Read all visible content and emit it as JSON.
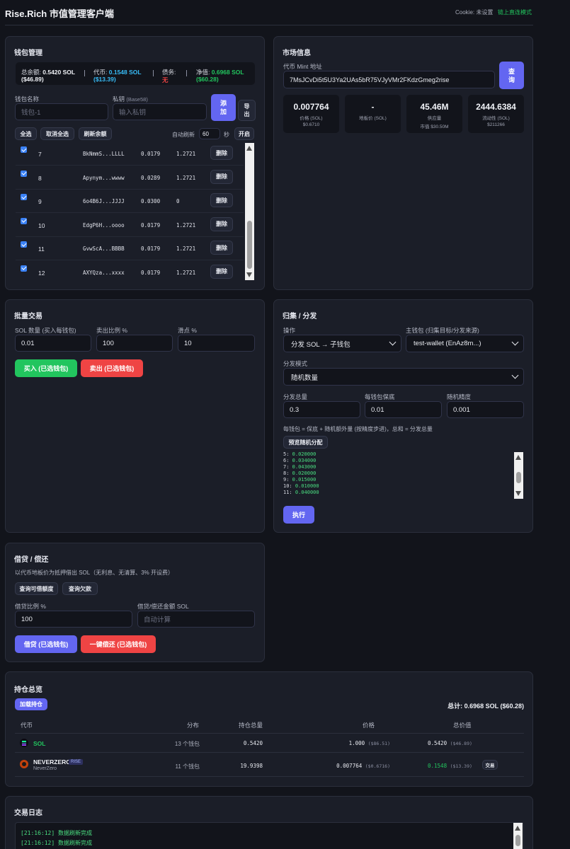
{
  "header": {
    "title": "Rise.Rich 市值管理客户端",
    "cookie_label": "Cookie: 未设置",
    "mode_label": "链上直连模式"
  },
  "wallet": {
    "title": "钱包管理",
    "summary": {
      "total_label": "总余额:",
      "total_value": "0.5420 SOL",
      "total_usd": "($46.89)",
      "token_label": "代币:",
      "token_value": "0.1548 SOL",
      "token_usd": "($13.39)",
      "debt_label": "债务:",
      "debt_value": "无",
      "net_label": "净值:",
      "net_value": "0.6968 SOL",
      "net_usd": "($60.28)"
    },
    "name_label": "钱包名称",
    "name_placeholder": "钱包-1",
    "key_label": "私钥",
    "key_hint": "(Base58)",
    "key_placeholder": "输入私钥",
    "add_button": "添加",
    "export_button": "导出",
    "select_all": "全选",
    "deselect_all": "取消全选",
    "refresh_balance": "刷新余额",
    "auto_refresh_label": "自动刷新",
    "auto_refresh_value": "60",
    "seconds_label": "秒",
    "start_button": "开启",
    "delete_label": "删除",
    "rows": [
      {
        "idx": "7",
        "addr": "BkNmmS...LLLL",
        "sol": "0.0179",
        "token": "1.2721",
        "checked": true
      },
      {
        "idx": "8",
        "addr": "Apynym...wwww",
        "sol": "0.0289",
        "token": "1.2721",
        "checked": true
      },
      {
        "idx": "9",
        "addr": "6o4B6J...JJJJ",
        "sol": "0.0300",
        "token": "0",
        "checked": true
      },
      {
        "idx": "10",
        "addr": "EdgP6H...oooo",
        "sol": "0.0179",
        "token": "1.2721",
        "checked": true
      },
      {
        "idx": "11",
        "addr": "GvwScA...BBBB",
        "sol": "0.0179",
        "token": "1.2721",
        "checked": true
      },
      {
        "idx": "12",
        "addr": "AXYQza...xxxx",
        "sol": "0.0179",
        "token": "1.2721",
        "checked": true
      }
    ]
  },
  "market": {
    "title": "市场信息",
    "mint_label": "代币 Mint 地址",
    "mint_value": "7MsJCvDi5t5U3Ya2UAs5bR75VJyVMr2FKdzGmeg2rise",
    "query_button": "查询",
    "stats": [
      {
        "value": "0.007764",
        "label": "价格 (SOL)",
        "sub": "$0.6710"
      },
      {
        "value": "-",
        "label": "地板价 (SOL)",
        "sub": ""
      },
      {
        "value": "45.46M",
        "label": "供应量",
        "sub": "市值 $30.50M"
      },
      {
        "value": "2444.6384",
        "label": "流动性 (SOL)",
        "sub": "$211266"
      }
    ]
  },
  "batch": {
    "title": "批量交易",
    "sol_label": "SOL 数量 (买入每钱包)",
    "sol_value": "0.01",
    "sell_label": "卖出比例 %",
    "sell_value": "100",
    "slip_label": "滑点 %",
    "slip_value": "10",
    "buy_button": "买入 (已选钱包)",
    "sell_button": "卖出 (已选钱包)"
  },
  "collect": {
    "title": "归集 / 分发",
    "op_label": "操作",
    "op_value": "分发 SOL → 子钱包",
    "main_label": "主钱包 (归集目标/分发来源)",
    "main_value": "test-wallet (EnAz8m...)",
    "mode_label": "分发模式",
    "mode_value": "随机数量",
    "total_label": "分发总量",
    "total_value": "0.3",
    "min_label": "每钱包保底",
    "min_value": "0.01",
    "precision_label": "随机精度",
    "precision_value": "0.001",
    "hint": "每钱包 = 保底 + 随机额外量 (按精度步进)，总和 = 分发总量",
    "preview_button": "预览随机分配",
    "execute_button": "执行",
    "preview": [
      {
        "k": "5:",
        "v": "0.020000"
      },
      {
        "k": "6:",
        "v": "0.034000"
      },
      {
        "k": "7:",
        "v": "0.043000"
      },
      {
        "k": "8:",
        "v": "0.020000"
      },
      {
        "k": "9:",
        "v": "0.015000"
      },
      {
        "k": "10:",
        "v": "0.010000"
      },
      {
        "k": "11:",
        "v": "0.040000"
      }
    ]
  },
  "loan": {
    "title": "借贷 / 偿还",
    "desc": "以代币地板价为抵押借出 SOL（无利息、无清算、3% 开设费）",
    "query_limit": "查询可借额度",
    "query_debt": "查询欠款",
    "ratio_label": "借贷比例 %",
    "ratio_value": "100",
    "amount_label": "借贷/偿还金额 SOL",
    "amount_placeholder": "自动计算",
    "borrow_button": "借贷 (已选钱包)",
    "repay_button": "一键偿还 (已选钱包)"
  },
  "holdings": {
    "title": "持仓总览",
    "load_button": "加载持仓",
    "total": "总计: 0.6968 SOL ($60.28)",
    "columns": [
      "代币",
      "分布",
      "持仓总量",
      "价格",
      "总价值"
    ],
    "rows": [
      {
        "name": "SOL",
        "sub": "",
        "badge": "",
        "dist": "13 个钱包",
        "amount": "0.5420",
        "price": "1.000",
        "price_usd": "($86.51)",
        "value": "0.5420",
        "value_usd": "($46.89)",
        "action": ""
      },
      {
        "name": "NEVERZERO",
        "sub": "NeverZero",
        "badge": "RISE",
        "dist": "11 个钱包",
        "amount": "19.9398",
        "price": "0.007764",
        "price_usd": "($0.6716)",
        "value": "0.1548",
        "value_usd": "($13.39)",
        "action": "交易"
      }
    ]
  },
  "log": {
    "title": "交易日志",
    "lines": [
      "[21:16:12] 数据刷新完成",
      "[21:16:12] 数据刷新完成"
    ]
  },
  "colors": {
    "accent": "#6366f1",
    "green": "#22c55e",
    "red": "#ef4444",
    "cyan": "#38bdf8"
  }
}
